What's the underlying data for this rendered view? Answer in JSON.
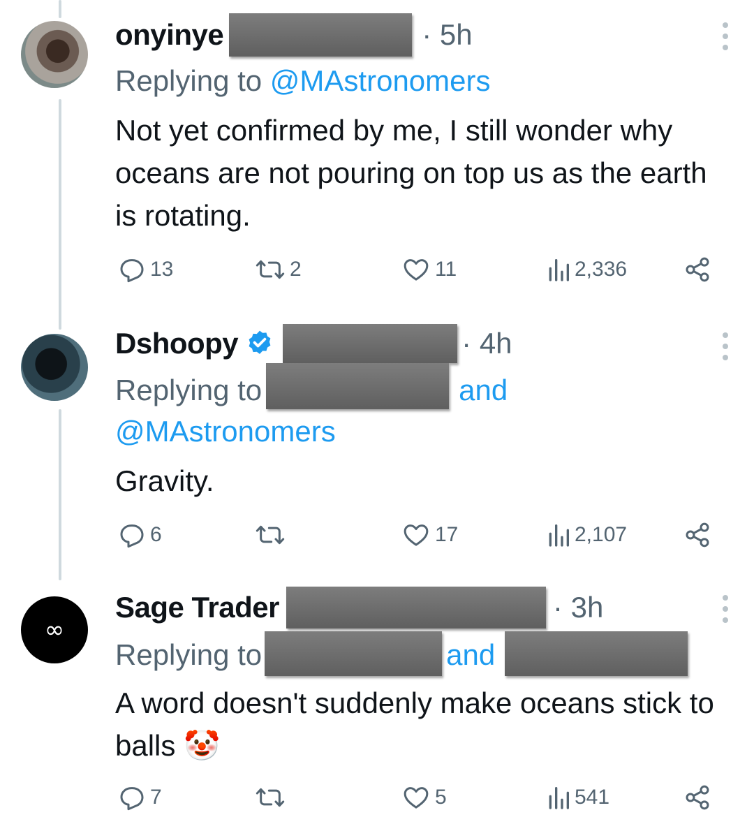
{
  "tweets": [
    {
      "name": "onyinye",
      "time": "· 5h",
      "replying_prefix": "Replying to ",
      "replying_handles": "@MAstronomers",
      "text": "Not yet confirmed by me, I still wonder why oceans are not pouring on top us as the earth is rotating.",
      "replies": "13",
      "reposts": "2",
      "likes": "11",
      "views": "2,336"
    },
    {
      "name": "Dshoopy",
      "time": "· 4h",
      "replying_prefix": "Replying to",
      "replying_and": "and",
      "replying_handle2": "@MAstronomers",
      "text": "Gravity.",
      "replies": "6",
      "reposts": "",
      "likes": "17",
      "views": "2,107"
    },
    {
      "name": "Sage Trader",
      "time": "· 3h",
      "replying_prefix": "Replying to",
      "replying_and": "and",
      "text": "A word doesn't suddenly make oceans stick to balls",
      "emoji": "🤡",
      "replies": "7",
      "reposts": "",
      "likes": "5",
      "views": "541"
    }
  ],
  "icons": {
    "reply": "reply-icon",
    "repost": "repost-icon",
    "like": "heart-icon",
    "views": "views-icon",
    "share": "share-icon",
    "more": "more-icon",
    "verified": "verified-badge-icon"
  },
  "colors": {
    "link": "#1d9bf0",
    "secondary": "#536471",
    "text": "#0f1419",
    "redaction": "#6b6b6b"
  }
}
